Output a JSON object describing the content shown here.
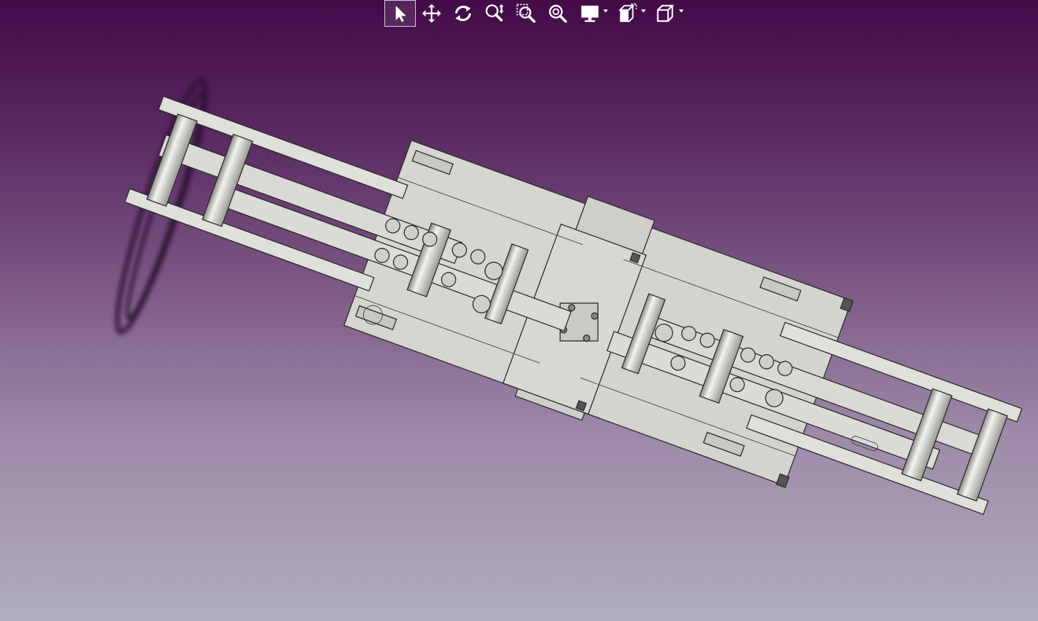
{
  "toolbar": {
    "buttons": [
      {
        "name": "select-tool",
        "icon": "cursor-arrow-icon",
        "active": true
      },
      {
        "name": "pan-tool",
        "icon": "move-arrows-icon"
      },
      {
        "name": "rotate-tool",
        "icon": "rotate-icon"
      },
      {
        "name": "zoom-tool",
        "icon": "zoom-updown-icon"
      },
      {
        "name": "zoom-window-tool",
        "icon": "zoom-box-icon"
      },
      {
        "name": "zoom-fit-tool",
        "icon": "zoom-fit-icon"
      },
      {
        "name": "display-mode-tool",
        "icon": "monitor-icon",
        "dropdown": true
      },
      {
        "name": "section-tool",
        "icon": "section-cube-icon",
        "dropdown": true
      },
      {
        "name": "view-orientation-tool",
        "icon": "cube-view-icon",
        "dropdown": true
      }
    ]
  },
  "colors": {
    "background_top": "#430a48",
    "background_bottom": "#b1adbf",
    "model_face": "#d6d6d0",
    "model_edge": "#2a2a2a",
    "icon": "#ffffff"
  }
}
